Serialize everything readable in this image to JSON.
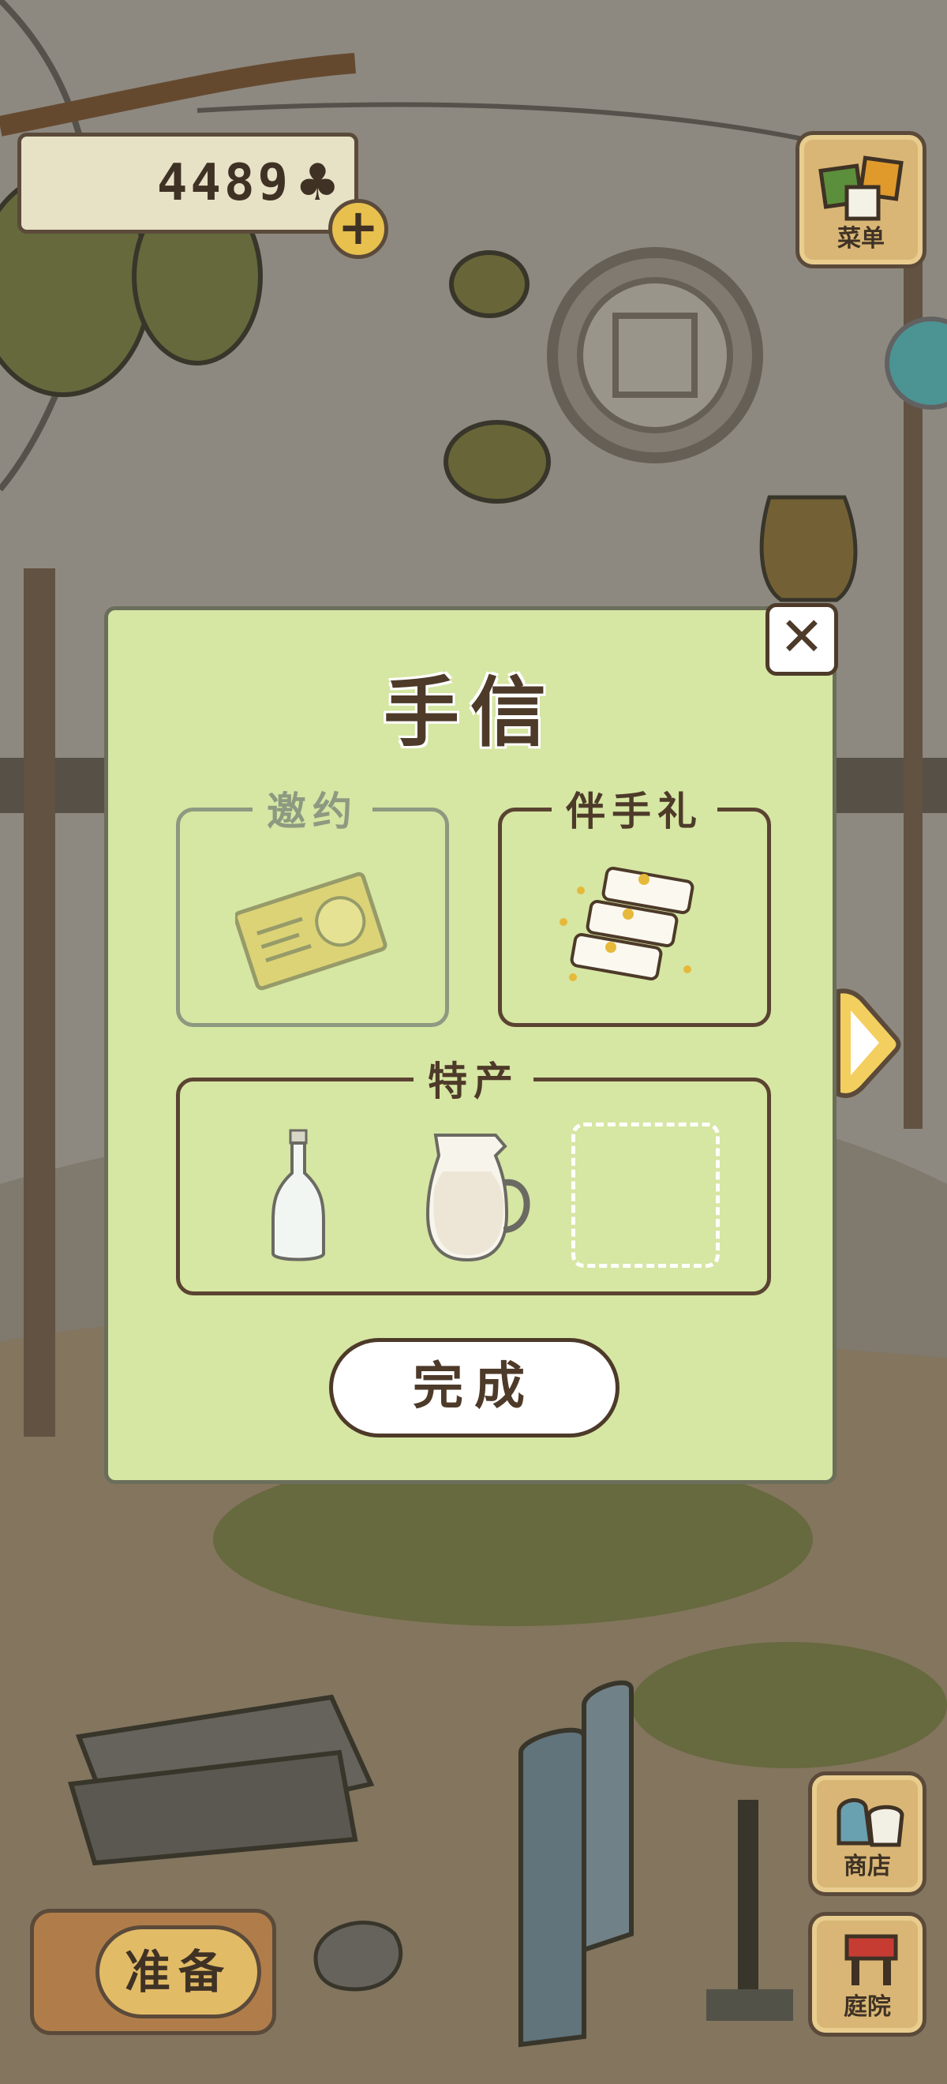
{
  "hud": {
    "clover_count": "4489",
    "clover_icon": "clover-icon",
    "plus_label": "+",
    "menu_label": "菜单",
    "shop_label": "商店",
    "yard_label": "庭院",
    "prepare_label": "准备"
  },
  "dialog": {
    "title": "手信",
    "close_label": "✕",
    "slots": {
      "invite_label": "邀约",
      "gift_label": "伴手礼",
      "specialty_label": "特产"
    },
    "done_label": "完成"
  },
  "colors": {
    "dialog_bg": "#d6e6a3",
    "outline": "#4d3a29",
    "wood": "#d9b675"
  }
}
